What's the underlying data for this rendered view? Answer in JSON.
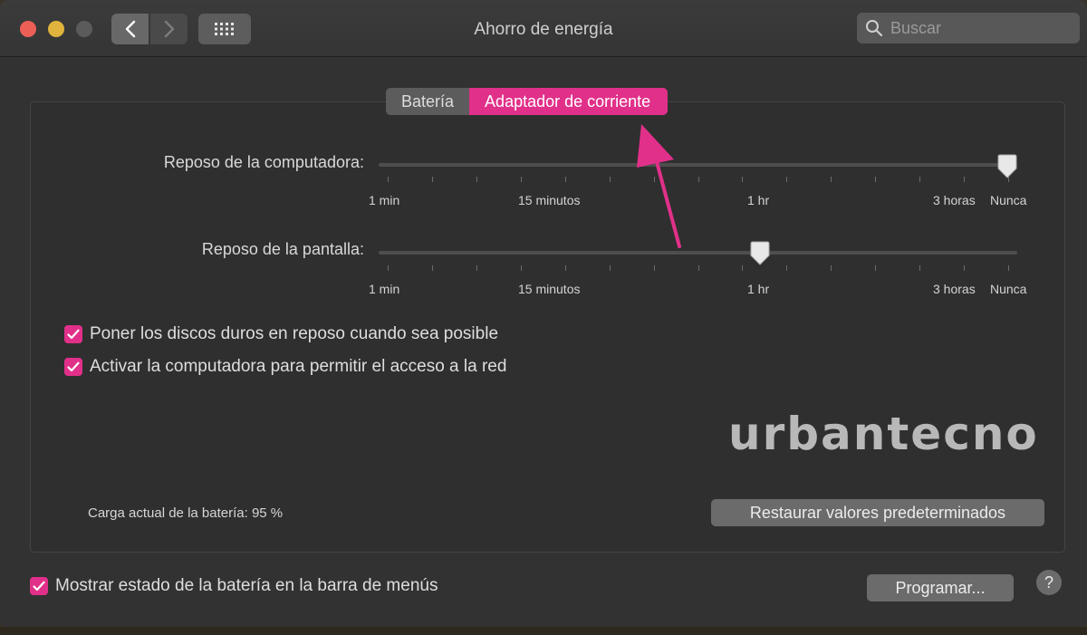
{
  "window": {
    "title": "Ahorro de energía"
  },
  "search": {
    "placeholder": "Buscar"
  },
  "tabs": [
    {
      "label": "Batería",
      "active": false
    },
    {
      "label": "Adaptador de corriente",
      "active": true
    }
  ],
  "computer_sleep": {
    "label": "Reposo de la computadora:",
    "value": "Nunca",
    "tick_labels": [
      "1 min",
      "15 minutos",
      "1 hr",
      "3 horas",
      "Nunca"
    ]
  },
  "display_sleep": {
    "label": "Reposo de la pantalla:",
    "value": "1 hr",
    "tick_labels": [
      "1 min",
      "15 minutos",
      "1 hr",
      "3 horas",
      "Nunca"
    ]
  },
  "options": {
    "disk_sleep": {
      "label": "Poner los discos duros en reposo cuando sea posible",
      "checked": true
    },
    "wake_network": {
      "label": "Activar la computadora para permitir el acceso a la red",
      "checked": true
    }
  },
  "watermark": "urbantecno",
  "battery_charge": "Carga actual de la batería: 95 %",
  "buttons": {
    "restore": "Restaurar valores predeterminados",
    "schedule": "Programar...",
    "help": "?"
  },
  "menu_bar_option": {
    "label": "Mostrar estado de la batería en la barra de menús",
    "checked": true
  },
  "colors": {
    "accent": "#e1308a",
    "window_bg": "#323232",
    "control": "#6b6b6b"
  },
  "icons": [
    "chevron-left-icon",
    "chevron-right-icon",
    "grid-icon",
    "search-icon",
    "checkmark-icon",
    "help-icon",
    "pointer-arrow-icon"
  ]
}
